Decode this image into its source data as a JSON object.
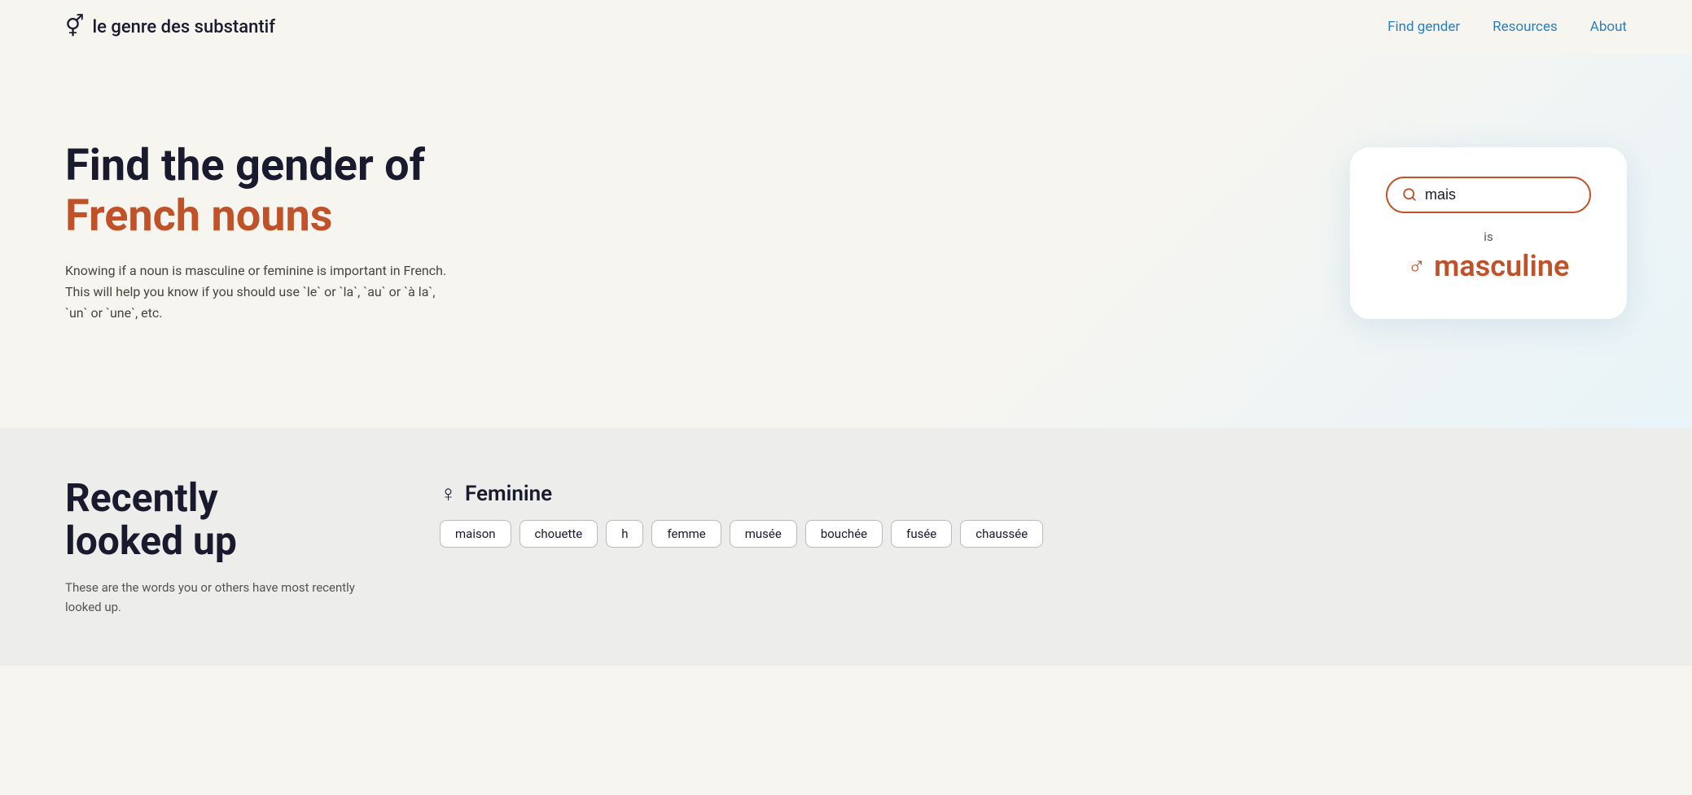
{
  "nav": {
    "logo_icon": "⚥",
    "logo_text": "le genre des substantif",
    "links": [
      {
        "label": "Find gender",
        "id": "find-gender"
      },
      {
        "label": "Resources",
        "id": "resources"
      },
      {
        "label": "About",
        "id": "about"
      }
    ]
  },
  "hero": {
    "title_line1": "Find the gender of",
    "title_line2": "French nouns",
    "description": "Knowing if a noun is masculine or feminine is important in French. This will help you know if you should use `le` or `la`, `au` or `à la`, `un` or `une`, etc.",
    "search_value": "mais",
    "search_placeholder": "Search a noun...",
    "result_is": "is",
    "result_icon": "♂",
    "result_label": "masculine"
  },
  "recently": {
    "title_line1": "Recently",
    "title_line2": "looked up",
    "description": "These are the words you or others have most recently looked up.",
    "feminine_symbol": "♀",
    "feminine_label": "Feminine",
    "feminine_words": [
      "maison",
      "chouette",
      "h",
      "femme",
      "musée",
      "bouchée",
      "fusée",
      "chaussée"
    ]
  }
}
